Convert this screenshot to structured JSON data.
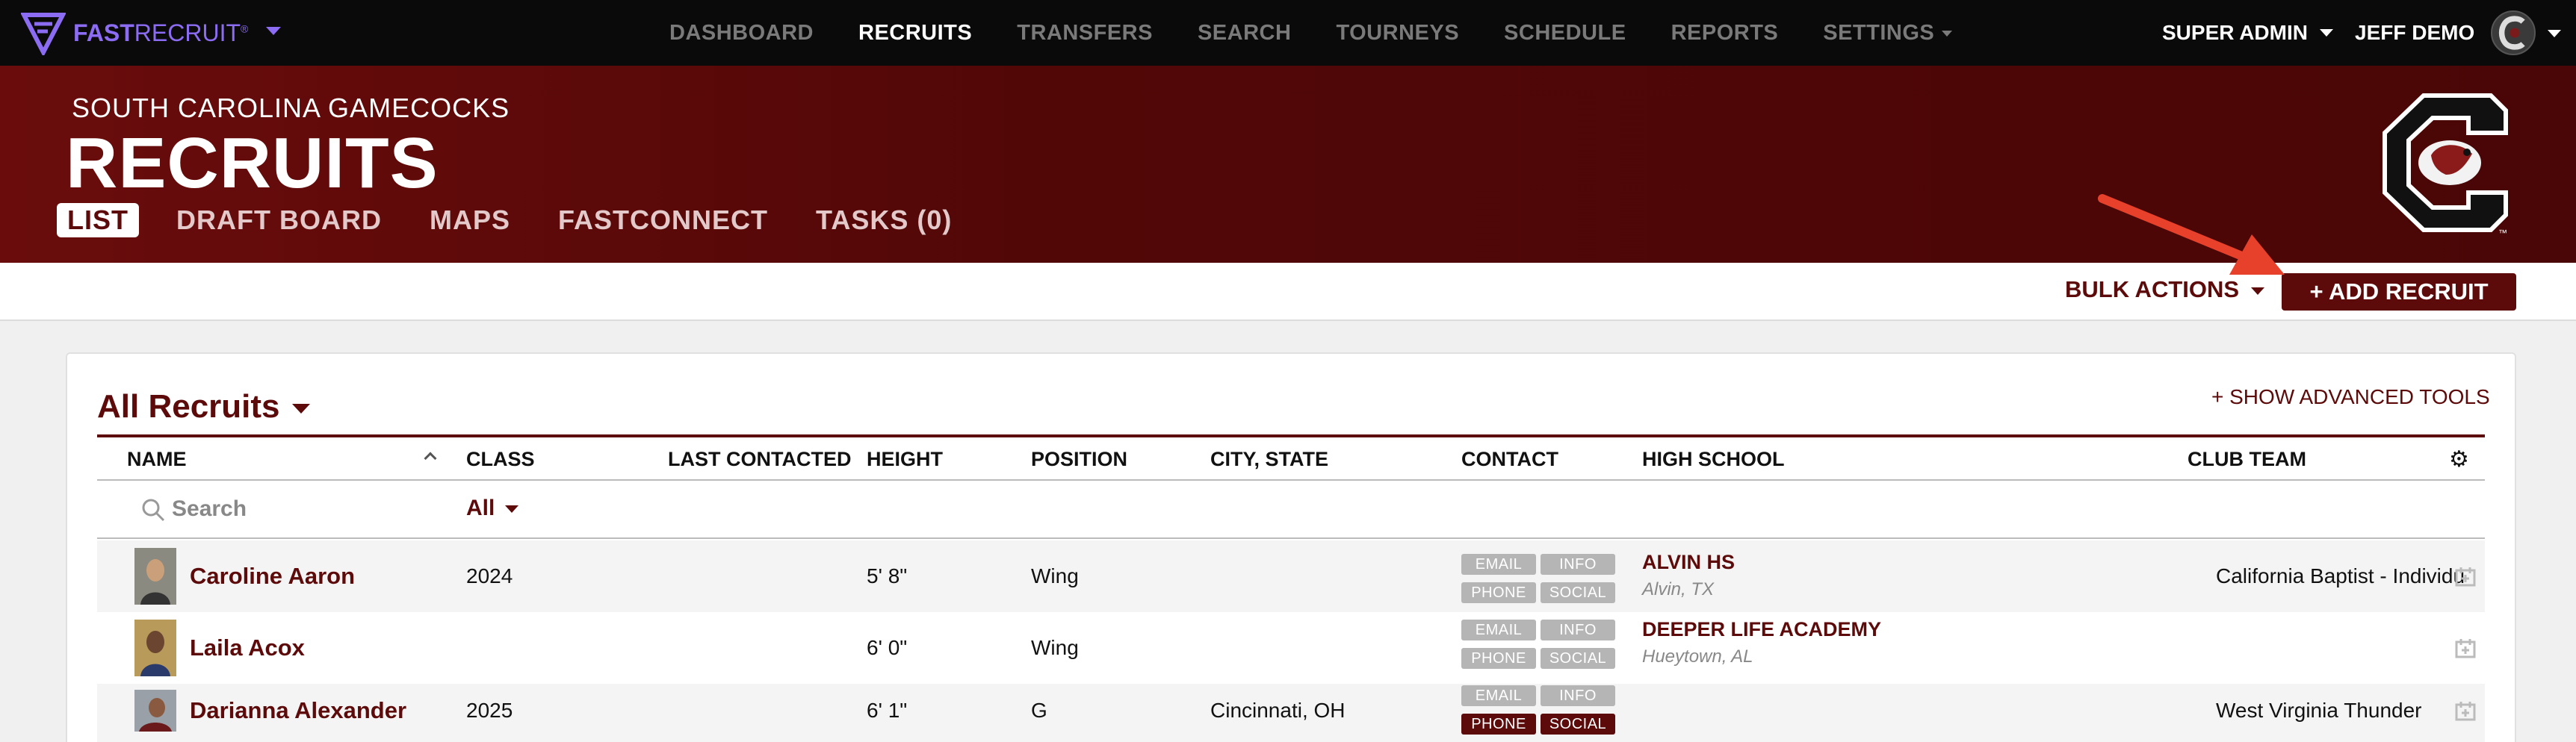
{
  "app": {
    "logo_text_bold": "FAST",
    "logo_text_light": "RECRUIT",
    "logo_tm": "®"
  },
  "nav": {
    "items": [
      {
        "label": "DASHBOARD"
      },
      {
        "label": "RECRUITS"
      },
      {
        "label": "TRANSFERS"
      },
      {
        "label": "SEARCH"
      },
      {
        "label": "TOURNEYS"
      },
      {
        "label": "SCHEDULE"
      },
      {
        "label": "REPORTS"
      },
      {
        "label": "SETTINGS"
      }
    ],
    "active": "RECRUITS",
    "role": "SUPER ADMIN",
    "user": "JEFF DEMO"
  },
  "header": {
    "team": "SOUTH CAROLINA GAMECOCKS",
    "title": "RECRUITS",
    "tabs": [
      {
        "label": "LIST"
      },
      {
        "label": "DRAFT BOARD"
      },
      {
        "label": "MAPS"
      },
      {
        "label": "FASTCONNECT"
      },
      {
        "label": "TASKS (0)"
      }
    ],
    "active_tab": "LIST"
  },
  "actions": {
    "bulk": "BULK ACTIONS",
    "add": "+ ADD RECRUIT"
  },
  "list": {
    "title": "All Recruits",
    "advanced": "+ SHOW ADVANCED TOOLS",
    "columns": {
      "name": "NAME",
      "class": "CLASS",
      "last_contacted": "LAST CONTACTED",
      "height": "HEIGHT",
      "position": "POSITION",
      "city_state": "CITY, STATE",
      "contact": "CONTACT",
      "high_school": "HIGH SCHOOL",
      "club_team": "CLUB TEAM"
    },
    "search_placeholder": "Search",
    "class_filter": "All",
    "contact_labels": {
      "email": "EMAIL",
      "info": "INFO",
      "phone": "PHONE",
      "social": "SOCIAL"
    },
    "rows": [
      {
        "name": "Caroline Aaron",
        "class": "2024",
        "height": "5' 8\"",
        "position": "Wing",
        "city": "",
        "hs": "ALVIN HS",
        "hs_loc": "Alvin, TX",
        "club": "California Baptist - Individual",
        "active": {
          "email": false,
          "info": false,
          "phone": false,
          "social": false
        }
      },
      {
        "name": "Laila Acox",
        "class": "",
        "height": "6' 0\"",
        "position": "Wing",
        "city": "",
        "hs": "DEEPER LIFE ACADEMY",
        "hs_loc": "Hueytown, AL",
        "club": "",
        "active": {
          "email": false,
          "info": false,
          "phone": false,
          "social": false
        }
      },
      {
        "name": "Darianna Alexander",
        "class": "2025",
        "height": "6' 1\"",
        "position": "G",
        "city": "Cincinnati, OH",
        "hs": "",
        "hs_loc": "",
        "club": "West Virginia Thunder",
        "active": {
          "email": false,
          "info": false,
          "phone": true,
          "social": true
        }
      }
    ]
  },
  "colors": {
    "brand": "#5c0a0a",
    "logo": "#8b6cf2",
    "annotation_arrow": "#e8412b"
  }
}
